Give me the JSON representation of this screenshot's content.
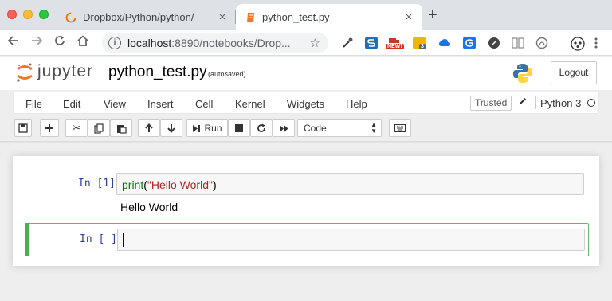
{
  "browser": {
    "tabs": [
      {
        "title": "Dropbox/Python/python/",
        "close": "×"
      },
      {
        "title": "python_test.py",
        "close": "×"
      }
    ],
    "new_tab": "+",
    "url_host": "localhost",
    "url_rest": ":8890/notebooks/Drop...",
    "ext_badges": {
      "new": "NEW!",
      "count": "3"
    }
  },
  "header": {
    "logo_text": "jupyter",
    "notebook_name": "python_test.py",
    "autosave": "(autosaved)",
    "logout_label": "Logout"
  },
  "menu": {
    "items": [
      "File",
      "Edit",
      "View",
      "Insert",
      "Cell",
      "Kernel",
      "Widgets",
      "Help"
    ],
    "trusted_label": "Trusted",
    "kernel_name": "Python 3"
  },
  "toolbar": {
    "run_label": "Run",
    "cell_type": "Code"
  },
  "cells": [
    {
      "prompt": "In [1]:",
      "code_func": "print",
      "code_open": "(",
      "code_string": "\"Hello World\"",
      "code_close": ")",
      "output": "Hello World"
    },
    {
      "prompt": "In [ ]:",
      "code": ""
    }
  ],
  "colors": {
    "prompt": "#303f9f",
    "selected_cell_border": "#66bb6a",
    "selected_cell_bar": "#4caf50"
  }
}
